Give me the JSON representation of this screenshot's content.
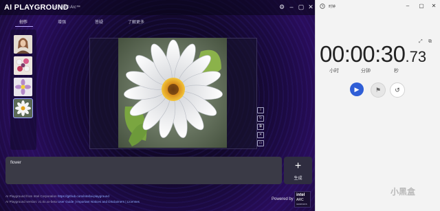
{
  "playground": {
    "brand": "AI PLAYGROUND",
    "brand_sub": "for Intel® Arc™",
    "tabs": [
      "创作",
      "增强",
      "答疑",
      "了解更多"
    ],
    "prompt_text": "flower",
    "generate_label": "生成",
    "footer_line1_prefix": "AI Playground from Intel Corporation",
    "footer_line1_link": "https://github.com/intel/ai-playground",
    "footer_line2_prefix": "AI Playground version: v1.0x.xx-beta",
    "footer_line2_links": "User Guide | Important Notices and Disclaimers | Licenses",
    "powered_by": "Powered by",
    "badge": {
      "line1": "intel",
      "line2": "ARC",
      "line3": "GRAPHICS"
    }
  },
  "timer": {
    "title": "时钟",
    "hours": "00",
    "minutes": "00",
    "seconds": "30",
    "fraction": ".73",
    "unit_hours": "小时",
    "unit_minutes": "分钟",
    "unit_seconds": "秒"
  },
  "watermark": "小黑盒",
  "colors": {
    "play_button": "#2f5ed6",
    "tab_active_underline": "#b9a8ff"
  }
}
